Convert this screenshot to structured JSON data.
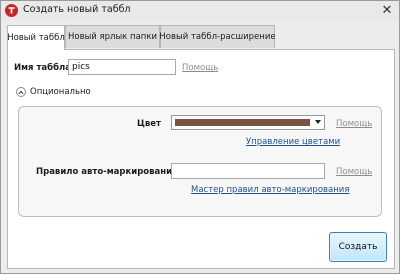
{
  "window": {
    "title": "Создать новый таббл",
    "close_glyph": "✕",
    "app_icon": "app-logo-icon"
  },
  "tabs": [
    {
      "label": "Новый таббл",
      "active": true
    },
    {
      "label": "Новый ярлык папки",
      "active": false
    },
    {
      "label": "Новый таббл-расширение",
      "active": false
    }
  ],
  "form": {
    "name_label": "Имя таббла",
    "name_value": "pics",
    "name_help": "Помощь",
    "optional_label": "Опционально",
    "color": {
      "label": "Цвет",
      "selected_color": "#7a5244",
      "help": "Помощь",
      "manage_link": "Управление цветами"
    },
    "autotag": {
      "label": "Правило авто-маркирования",
      "value": "",
      "help": "Помощь",
      "wizard_link": "Мастер правил авто-маркирования"
    },
    "create_button": "Создать"
  }
}
